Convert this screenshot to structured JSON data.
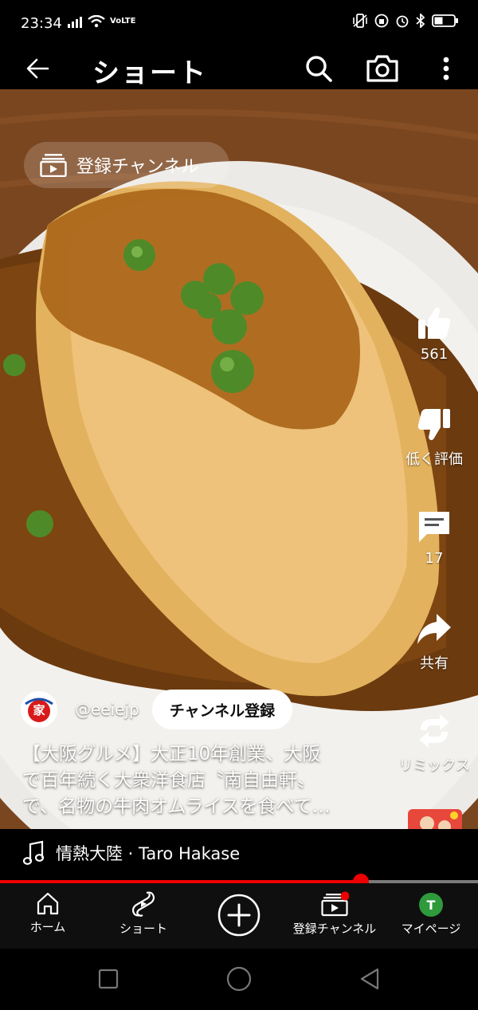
{
  "status": {
    "time": "23:34",
    "network": "VoLTE"
  },
  "appbar": {
    "title": "ショート"
  },
  "video": {
    "subscriptions_chip": "登録チャンネル",
    "rail": {
      "like_count": "561",
      "dislike_label": "低く評価",
      "comment_count": "17",
      "share_label": "共有",
      "remix_label": "リミックス"
    },
    "channel": {
      "handle": "@eeiejp",
      "subscribe_label": "チャンネル登録",
      "avatar_glyph": "家"
    },
    "caption_lines": [
      "【大阪グルメ】大正10年創業、大阪",
      "で百年続く大衆洋食店〝南自由軒〟",
      "で、名物の牛肉オムライスを食べて…"
    ]
  },
  "music": {
    "track": "情熱大陸 · Taro Hakase"
  },
  "progress": {
    "fraction": 0.755
  },
  "bottom_nav": {
    "home": "ホーム",
    "shorts": "ショート",
    "subscriptions": "登録チャンネル",
    "mypage": "マイページ",
    "avatar_letter": "T"
  },
  "colors": {
    "accent_red": "#e00000",
    "avatar_green": "#2e9a3c"
  }
}
